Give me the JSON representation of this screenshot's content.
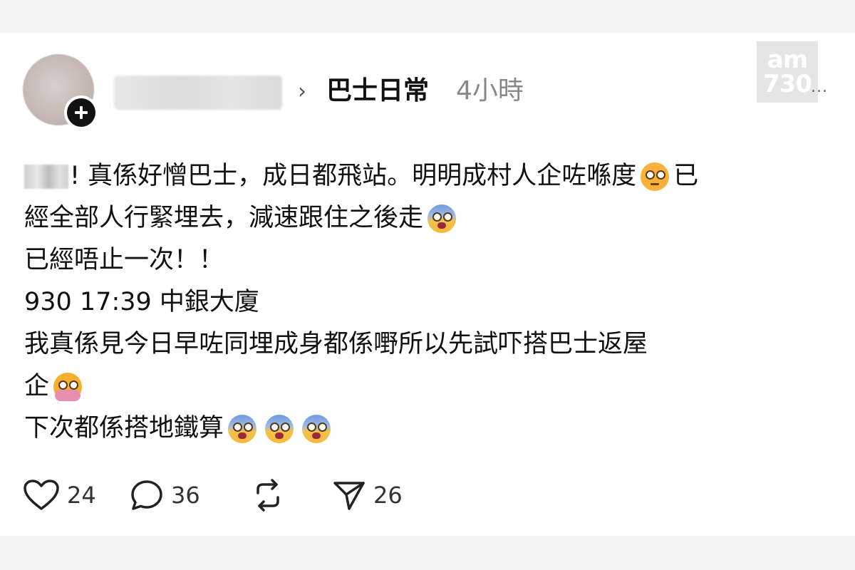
{
  "post": {
    "community": "巴士日常",
    "separator": "›",
    "timestamp": "4小時",
    "more_label": "...",
    "watermark_top": "am",
    "watermark_bottom": "730",
    "body": {
      "line1_a": "! 真係好憎巴士，成日都飛站。明明成村人企咗喺度",
      "line1_b": "已",
      "line2": "經全部人行緊埋去，減速跟住之後走",
      "line3": "已經唔止一次！！",
      "line4": "930 17:39 中銀大廈",
      "line5": "我真係見今日早咗同埋成身都係嘢所以先試吓搭巴士返屋",
      "line6": "企",
      "line7": "下次都係搭地鐵算"
    },
    "emojis": [
      "dizzy-face",
      "fearful-face",
      "hot-face",
      "fearful-face",
      "fearful-face",
      "fearful-face"
    ]
  },
  "actions": {
    "like_count": "24",
    "reply_count": "36",
    "share_count": "26"
  },
  "icons": {
    "like": "heart-icon",
    "reply": "comment-bubble-icon",
    "repost": "repost-icon",
    "share": "paper-plane-icon",
    "follow": "plus-icon"
  }
}
